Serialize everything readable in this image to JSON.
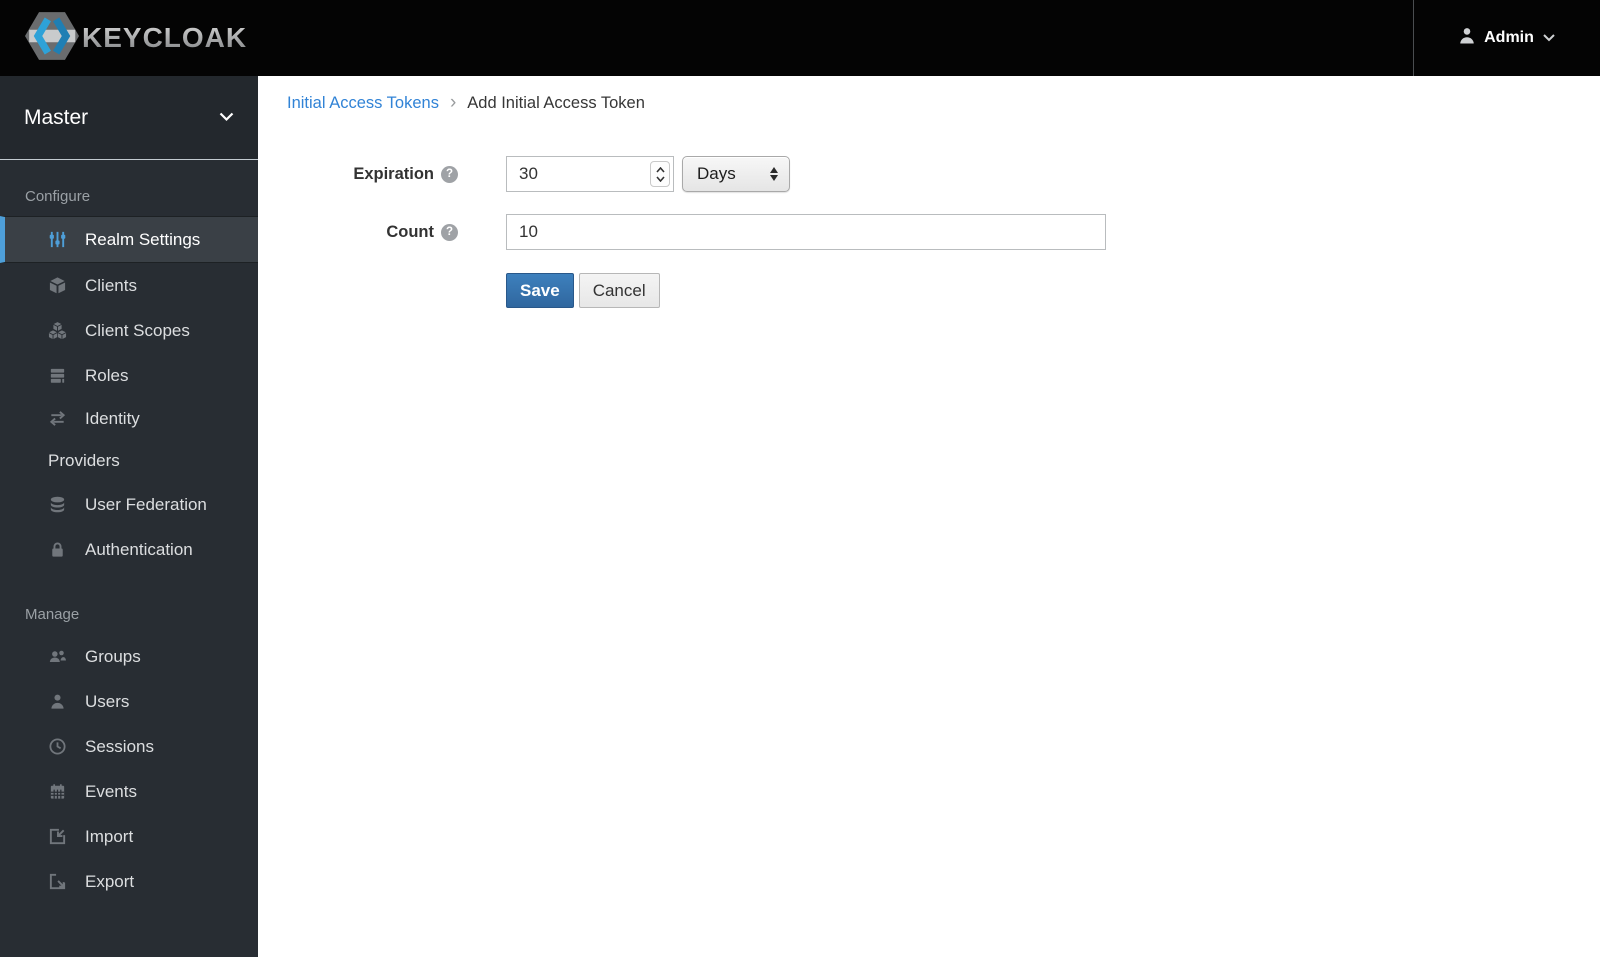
{
  "topbar": {
    "brand": "KEYCLOAK",
    "user_label": "Admin"
  },
  "sidebar": {
    "realm_name": "Master",
    "configure_header": "Configure",
    "manage_header": "Manage",
    "items": [
      {
        "label": "Realm Settings",
        "icon": "sliders-icon",
        "active": true
      },
      {
        "label": "Clients",
        "icon": "cube-icon",
        "active": false
      },
      {
        "label": "Client Scopes",
        "icon": "cubes-icon",
        "active": false
      },
      {
        "label": "Roles",
        "icon": "stack-icon",
        "active": false
      },
      {
        "label": "Identity Providers",
        "icon": "exchange-arrows-icon",
        "active": false
      },
      {
        "label": "User Federation",
        "icon": "database-icon",
        "active": false
      },
      {
        "label": "Authentication",
        "icon": "lock-icon",
        "active": false
      },
      {
        "label": "Groups",
        "icon": "group-icon",
        "active": false
      },
      {
        "label": "Users",
        "icon": "user-icon",
        "active": false
      },
      {
        "label": "Sessions",
        "icon": "clock-icon",
        "active": false
      },
      {
        "label": "Events",
        "icon": "calendar-icon",
        "active": false
      },
      {
        "label": "Import",
        "icon": "import-icon",
        "active": false
      },
      {
        "label": "Export",
        "icon": "export-icon",
        "active": false
      }
    ]
  },
  "breadcrumb": {
    "parent": "Initial Access Tokens",
    "separator": "›",
    "current": "Add Initial Access Token"
  },
  "form": {
    "expiration": {
      "label": "Expiration",
      "value": "30",
      "unit": "Days"
    },
    "count": {
      "label": "Count",
      "value": "10"
    },
    "save_label": "Save",
    "cancel_label": "Cancel"
  },
  "colors": {
    "topbar_bg": "#040404",
    "sidebar_bg": "#282d33",
    "active_item_bg": "#3a4046",
    "accent_blue": "#4e9fd9",
    "link_blue": "#3183d6",
    "primary_button_blue": "#3276b1"
  }
}
